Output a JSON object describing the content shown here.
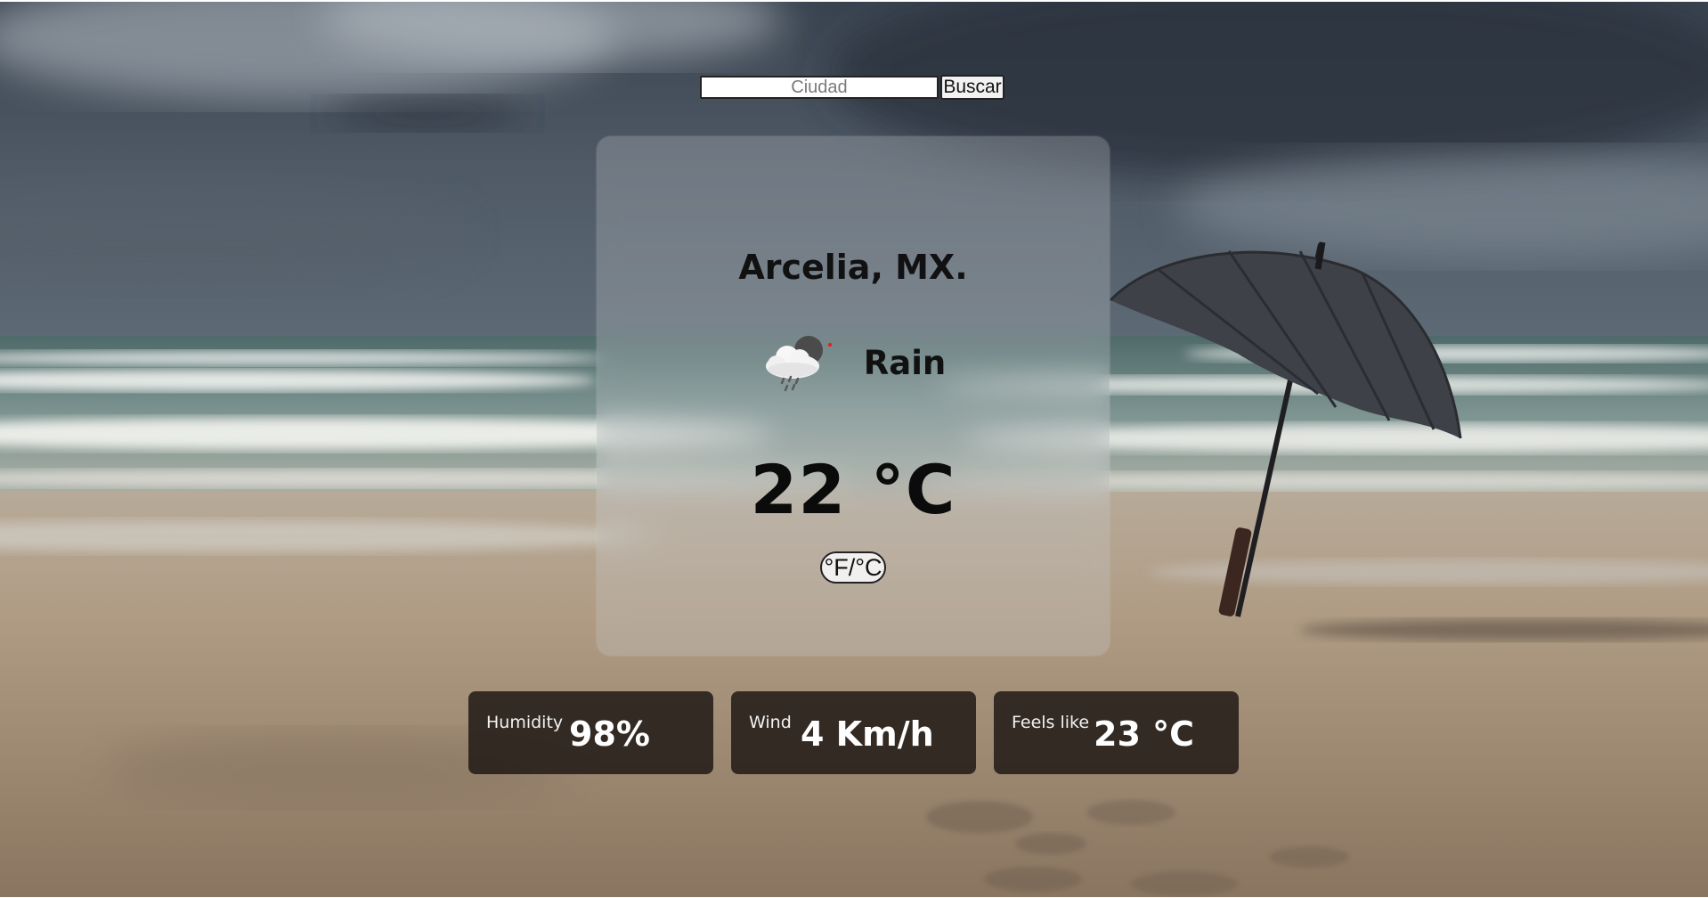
{
  "search": {
    "placeholder": "Ciudad",
    "value": "",
    "button_label": "Buscar"
  },
  "weather": {
    "city": "Arcelia, MX.",
    "condition": "Rain",
    "condition_icon": "rain-cloud-icon",
    "temperature": "22 °C",
    "unit_toggle_label": "°F/°C"
  },
  "stats": [
    {
      "label": "Humidity",
      "value": "98%"
    },
    {
      "label": "Wind",
      "value": "4 Km/h"
    },
    {
      "label": "Feels like",
      "value": "23 °C"
    }
  ],
  "colors": {
    "stat_box_bg": "#231c18",
    "text_dark": "#111111",
    "text_light": "#ffffff"
  }
}
